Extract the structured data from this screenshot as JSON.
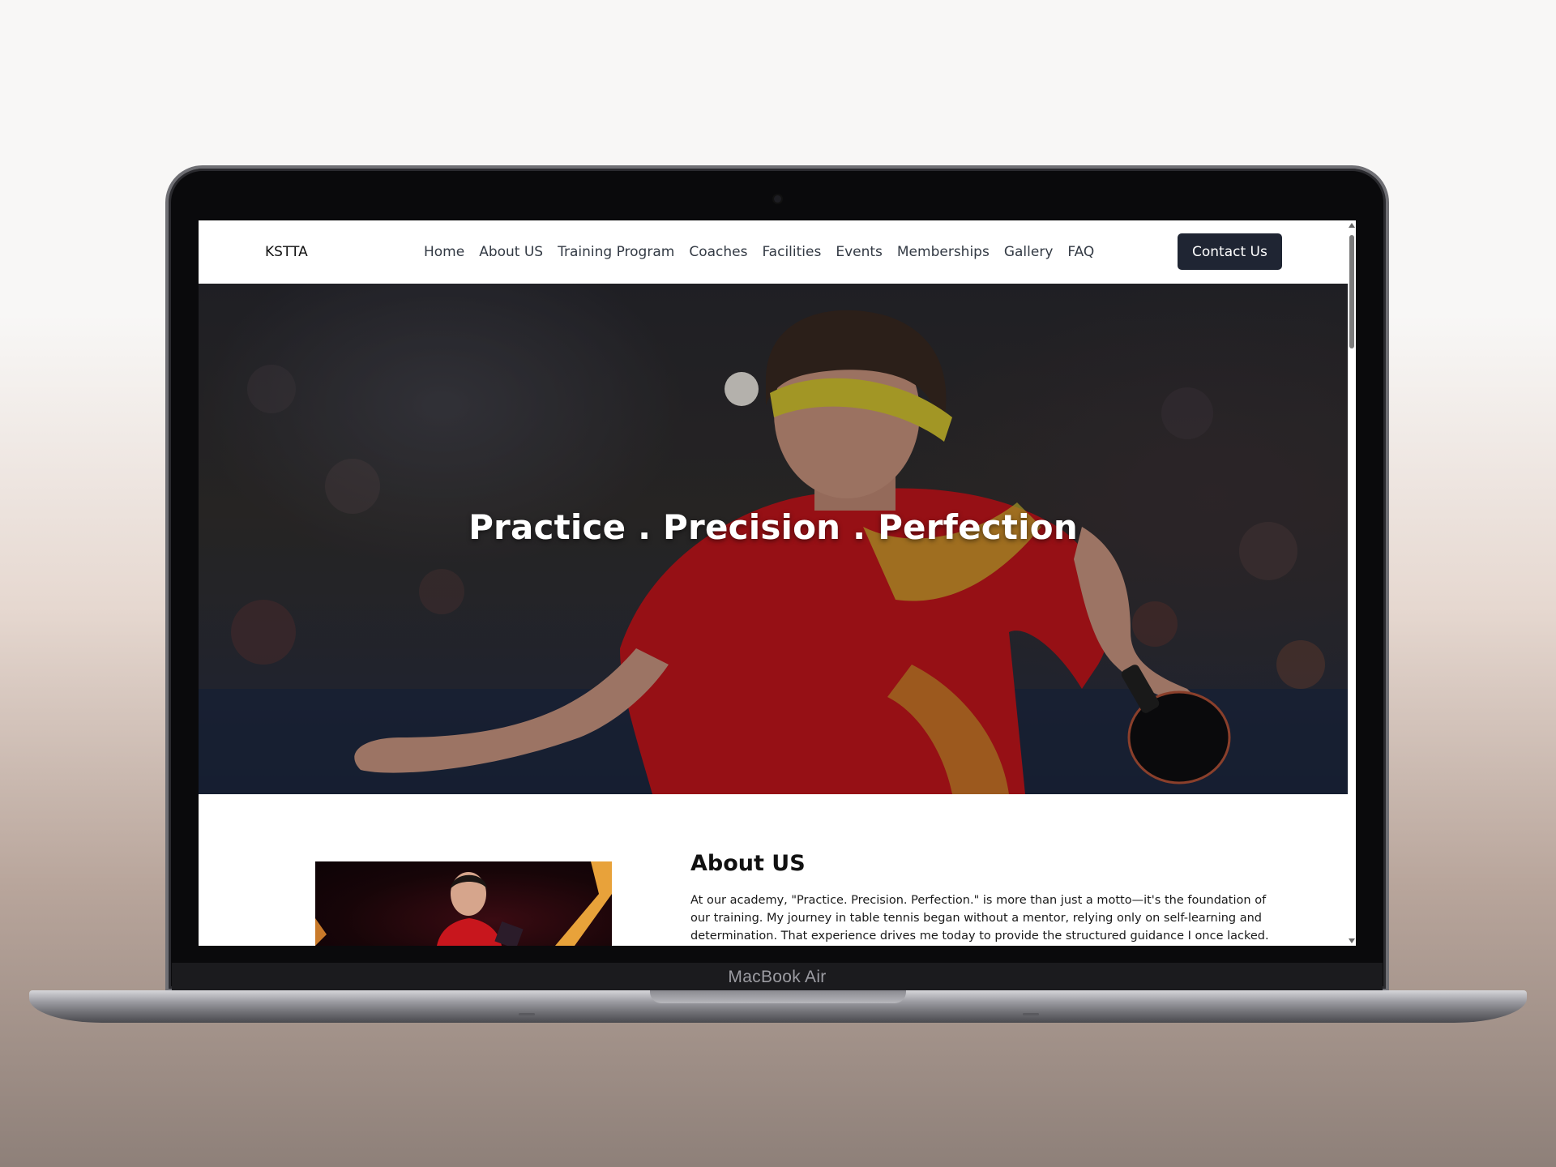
{
  "device": {
    "label": "MacBook Air"
  },
  "site": {
    "brand": "KSTTA",
    "nav": [
      "Home",
      "About US",
      "Training Program",
      "Coaches",
      "Facilities",
      "Events",
      "Memberships",
      "Gallery",
      "FAQ"
    ],
    "cta": "Contact Us"
  },
  "hero": {
    "title": "Practice . Precision . Perfection"
  },
  "about": {
    "heading": "About US",
    "body": "At our academy, \"Practice. Precision. Perfection.\" is more than just a motto—it's the foundation of our training. My journey in table tennis began without a mentor, relying only on self-learning and determination. That experience drives me today to provide the structured guidance I once lacked. As a"
  },
  "colors": {
    "cta_bg": "#1f2533",
    "jersey_red": "#c8161d",
    "headband_yellow": "#d8c932"
  }
}
